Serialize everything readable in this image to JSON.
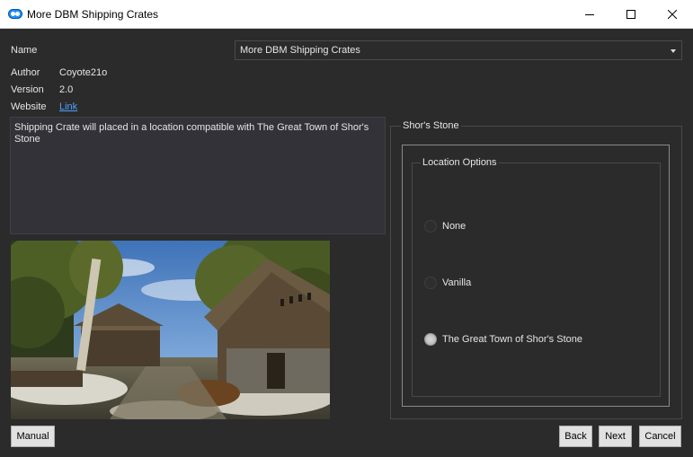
{
  "window": {
    "title": "More DBM Shipping Crates",
    "controls": {
      "minimize": "minimize-icon",
      "maximize": "maximize-icon",
      "close": "close-icon"
    }
  },
  "info": {
    "name_label": "Name",
    "name_value": "More DBM Shipping Crates",
    "author_label": "Author",
    "author_value": "Coyote21o",
    "version_label": "Version",
    "version_value": "2.0",
    "website_label": "Website",
    "website_link": "Link"
  },
  "description": "Shipping Crate will placed in a location compatible with The Great Town of Shor's Stone",
  "step": {
    "group_title": "Shor's Stone",
    "options_title": "Location Options",
    "options": [
      {
        "label": "None",
        "selected": false
      },
      {
        "label": "Vanilla",
        "selected": false
      },
      {
        "label": "The Great Town of Shor's Stone",
        "selected": true
      }
    ]
  },
  "buttons": {
    "manual": "Manual",
    "back": "Back",
    "next": "Next",
    "cancel": "Cancel"
  },
  "colors": {
    "background": "#2b2b2b",
    "link": "#4ea1ff",
    "button_face": "#e1e1e1"
  }
}
